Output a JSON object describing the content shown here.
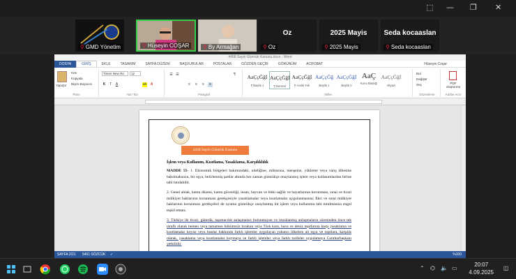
{
  "zoom": {
    "window_controls": {
      "minimize": "—",
      "restore": "❐",
      "close": "✕"
    },
    "right_icon": "⬚"
  },
  "participants": [
    {
      "name": "GMD Yönetim",
      "kind": "video"
    },
    {
      "name": "Hüseyin COŞAR",
      "kind": "video",
      "speaking": true
    },
    {
      "name": "By Armağan",
      "kind": "video"
    },
    {
      "name": "Oz",
      "display": "Oz",
      "kind": "text"
    },
    {
      "name": "2025 Mayis",
      "display": "2025 Mayis",
      "kind": "text"
    },
    {
      "name": "Seda kocaaslan",
      "display": "Seda kocaaslan",
      "kind": "text"
    }
  ],
  "word": {
    "title": "4458 Sayılı Gümrük Kanunu.docx - Word",
    "tabs": [
      "DOSYA",
      "GİRİŞ",
      "EKLE",
      "TASARIM",
      "SAYFA DÜZENİ",
      "BAŞVURULAR",
      "POSTALAR",
      "GÖZDEN GEÇİR",
      "GÖRÜNÜM",
      "ACROBAT"
    ],
    "user": "Hüseyin Coşar",
    "clipboard": {
      "paste": "Yapıştır",
      "cut": "Kes",
      "copy": "Kopyala",
      "painter": "Biçim Boyacısı",
      "label": "Pano"
    },
    "font": {
      "name": "Times New Ro",
      "size": "12",
      "label": "Yazı Tipi"
    },
    "paragraph_label": "Paragraf",
    "styles": [
      {
        "preview": "AaÇçĞğİ",
        "name": "¶ Başlık 1"
      },
      {
        "preview": "AaÇçĞğİ",
        "name": "¶ Normal"
      },
      {
        "preview": "AaÇçĞğİ",
        "name": "¶ Aralık Yok"
      },
      {
        "preview": "AaÇçĞğ",
        "name": "Başlık 1"
      },
      {
        "preview": "AaÇçĞğİ",
        "name": "Başlık 2"
      },
      {
        "preview": "AaÇ",
        "name": "Konu Başlığı"
      },
      {
        "preview": "AaÇçĞğİ",
        "name": "Altyazı"
      }
    ],
    "styles_label": "Stiller",
    "editing": {
      "find": "Bul",
      "replace": "Değiştir",
      "select": "Seç",
      "label": "Düzenleme"
    },
    "pdf": {
      "label": "PDF oluşturma",
      "group": "Adobe Acro"
    },
    "document": {
      "badge": "4458 Sayılı Gümrük Kanunu",
      "heading": "İşlem veya Kullanım, Kısıtlama, Yasaklama, Karşılıklılık",
      "madde_label": "MADDE 55-",
      "p1": " 1. Ekonomik bölgeleri bakımındaki, niteliğine, miktarına, menşeine, yükleme veya varış ülkesine bakılmaksızın, bir eşya, belirlenmiş şartlar altında her zaman gümrükçe onaylanmış işlem veya kullanımlardan birine tabi tutulabilir.",
      "p2": "2. Genel ahlak, kamu düzeni, kamu güvenliği, insan, hayvan ve bitki sağlık ve hayatlarının korunması, sınai ve ticari mülkiyet haklarının korunması gerekçesiyle yasaklamalar veya kısıtlamalar uygulanmasına; fikri ve sınai mülkiyet haklarının korunması gerekçeleri de uyumu gümrükçe onaylanmış bir işlem veya kullanıma tabi tutulmasına engel teşkil etmez.",
      "p3": "3. Türkiye ile ticari, gümrük, taşımacılık anlaşmaları bulunmayan ve imzalanmış anlaşmaların süresinden önce tek taraflı olarak hemen veya tamamen hükümsüz bırakan veya Türk kara, hava ve deniz taşıtlarına karşı yasaklama ve kısıtlamalar koyan veya bunlar hakkında farklı işlemler uygulayan yabancı ülkelere ait eşya ve taşıtlara, karşılık olarak, yasaklama veya kısıtlamalar koymaya ve farklı işlemler veya farklı tarifeler uygulamaya Cumhurbaşkanı yetkilidir."
    },
    "status": {
      "page": "SAYFA 2/21",
      "words": "5401 SÖZCÜK",
      "lang": "✓",
      "zoom": "%100"
    }
  },
  "taskbar": {
    "time": "20:07",
    "date": "4.09.2025",
    "apps": [
      "windows-icon",
      "search-icon",
      "task-view-icon",
      "chrome-icon",
      "whatsapp-icon",
      "spotify-icon",
      "zoom-icon",
      "obs-icon"
    ]
  }
}
